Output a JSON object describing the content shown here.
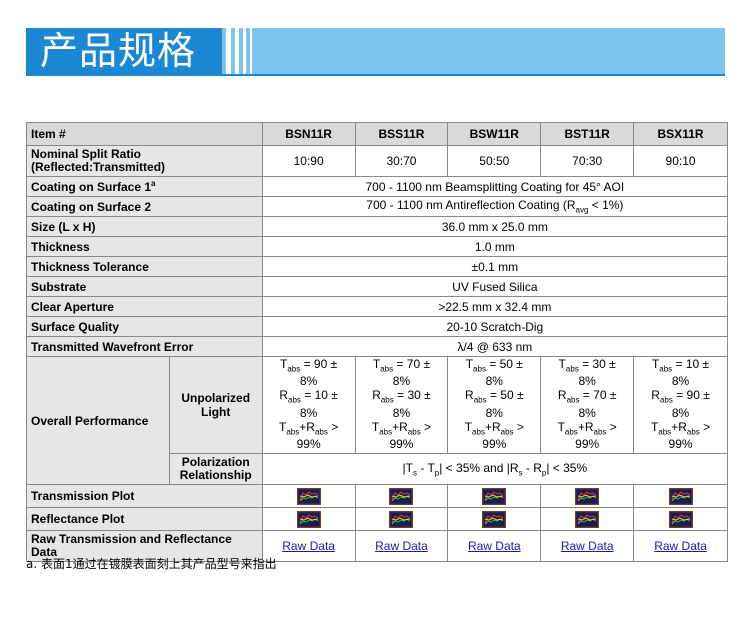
{
  "header": {
    "title": "产品规格"
  },
  "table": {
    "col_item": "Item #",
    "parts": [
      "BSN11R",
      "BSS11R",
      "BSW11R",
      "BST11R",
      "BSX11R"
    ],
    "split_ratio_label": "Nominal Split Ratio (Reflected:Transmitted)",
    "split_ratios": [
      "10:90",
      "30:70",
      "50:50",
      "70:30",
      "90:10"
    ],
    "coating1_label": "Coating on Surface 1",
    "coating1_sup": "a",
    "coating1_value": "700 - 1100 nm Beamsplitting Coating for 45° AOI",
    "coating2_label": "Coating on Surface 2",
    "coating2_value_pre": "700 - 1100 nm Antireflection Coating (R",
    "coating2_value_sub": "avg",
    "coating2_value_post": " < 1%)",
    "size_label": "Size (L x H)",
    "size_value": "36.0 mm x 25.0 mm",
    "thickness_label": "Thickness",
    "thickness_value": "1.0 mm",
    "tolerance_label": "Thickness Tolerance",
    "tolerance_value": "±0.1 mm",
    "substrate_label": "Substrate",
    "substrate_value": "UV Fused Silica",
    "aperture_label": "Clear Aperture",
    "aperture_value": ">22.5 mm x 32.4 mm",
    "quality_label": "Surface Quality",
    "quality_value": "20-10 Scratch-Dig",
    "wavefront_label": "Transmitted Wavefront Error",
    "wavefront_value": "λ/4 @ 633 nm",
    "overall_label": "Overall Performance",
    "unpolarized_label": "Unpolarized Light",
    "t_values": [
      "90",
      "70",
      "50",
      "30",
      "10"
    ],
    "r_values": [
      "10",
      "30",
      "50",
      "70",
      "90"
    ],
    "tolerance_pct": "8%",
    "sum_value": "99%",
    "polarization_label": "Polarization Relationship",
    "polarization_value": "|Ts - Tp| < 35% and |Rs - Rp| < 35%",
    "transmission_label": "Transmission Plot",
    "reflectance_label": "Reflectance Plot",
    "raw_label": "Raw Transmission and Reflectance Data",
    "raw_link": "Raw Data"
  },
  "footnote": "a. 表面1通过在镀膜表面刻上其产品型号来指出",
  "icons": {
    "plot": "plot-thumbnail-icon"
  },
  "colors": {
    "banner_dark": "#1c88d4",
    "banner_light": "#7cc4ee",
    "link": "#1a1aa6"
  }
}
